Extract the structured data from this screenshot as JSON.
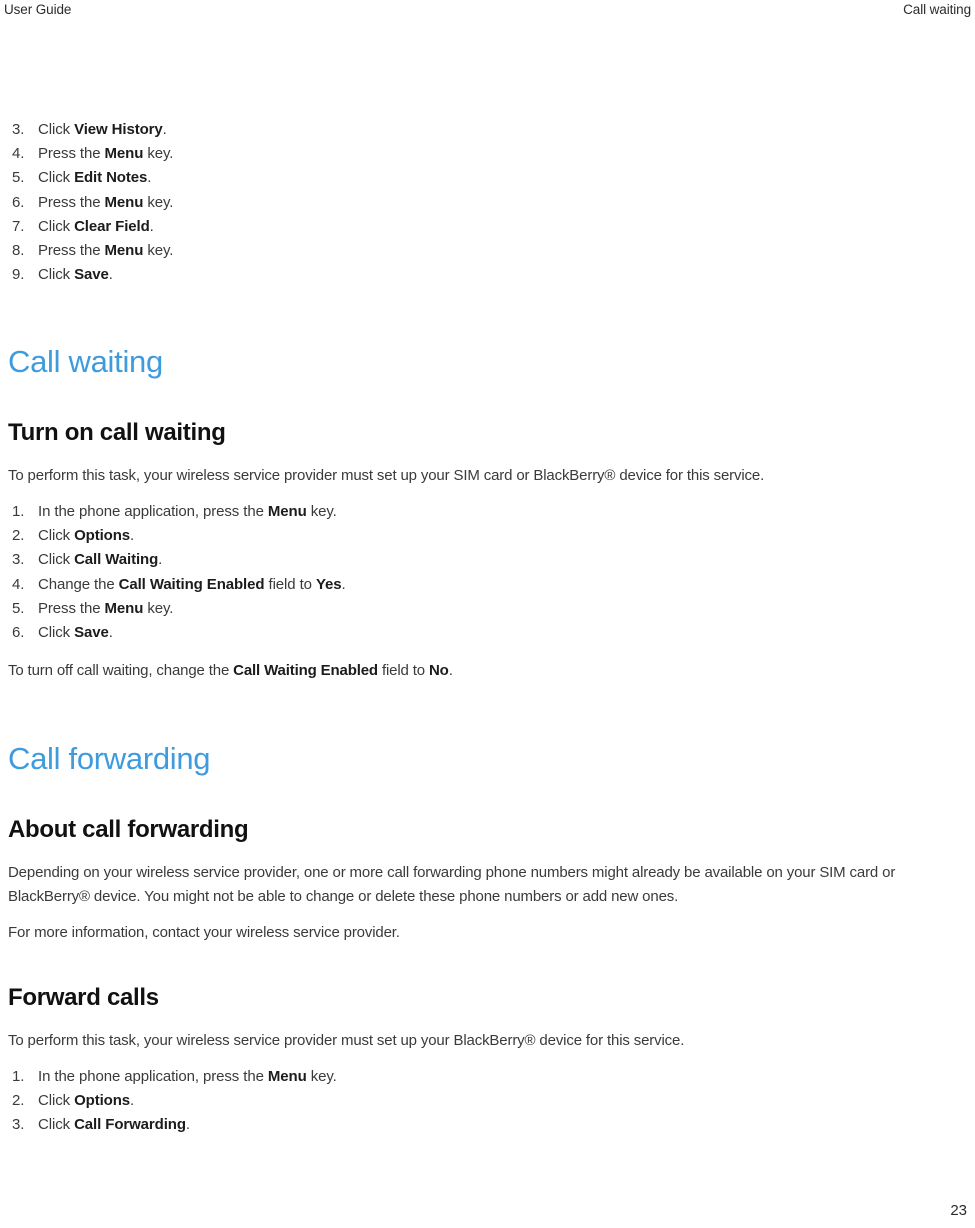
{
  "header": {
    "left": "User Guide",
    "right": "Call waiting"
  },
  "colors": {
    "chapter_heading": "#3e9bdd",
    "section_heading": "#111111",
    "body_text": "#3a3a3a",
    "page_background": "#ffffff"
  },
  "continued_list": {
    "items": [
      {
        "num": "3.",
        "html": "Click <b>View History</b>."
      },
      {
        "num": "4.",
        "html": "Press the <b>Menu</b> key."
      },
      {
        "num": "5.",
        "html": "Click <b>Edit Notes</b>."
      },
      {
        "num": "6.",
        "html": "Press the <b>Menu</b> key."
      },
      {
        "num": "7.",
        "html": "Click <b>Clear Field</b>."
      },
      {
        "num": "8.",
        "html": "Press the <b>Menu</b> key."
      },
      {
        "num": "9.",
        "html": "Click <b>Save</b>."
      }
    ]
  },
  "call_waiting": {
    "chapter_title": "Call waiting",
    "section_title": "Turn on call waiting",
    "intro": "To perform this task, your wireless service provider must set up your SIM card or BlackBerry® device for this service.",
    "steps": [
      {
        "num": "1.",
        "html": "In the phone application, press the <b>Menu</b> key."
      },
      {
        "num": "2.",
        "html": "Click <b>Options</b>."
      },
      {
        "num": "3.",
        "html": "Click <b>Call Waiting</b>."
      },
      {
        "num": "4.",
        "html": "Change the <b>Call Waiting Enabled</b> field to <b>Yes</b>."
      },
      {
        "num": "5.",
        "html": "Press the <b>Menu</b> key."
      },
      {
        "num": "6.",
        "html": "Click <b>Save</b>."
      }
    ],
    "outro_html": "To turn off call waiting, change the <b>Call Waiting Enabled</b> field to <b>No</b>."
  },
  "call_forwarding": {
    "chapter_title": "Call forwarding",
    "about_title": "About call forwarding",
    "about_paragraph": "Depending on your wireless service provider, one or more call forwarding phone numbers might already be available on your SIM card or BlackBerry® device. You might not be able to change or delete these phone numbers or add new ones.",
    "about_paragraph_2": "For more information, contact your wireless service provider.",
    "forward_title": "Forward calls",
    "forward_intro": "To perform this task, your wireless service provider must set up your BlackBerry® device for this service.",
    "forward_steps": [
      {
        "num": "1.",
        "html": "In the phone application, press the <b>Menu</b> key."
      },
      {
        "num": "2.",
        "html": "Click <b>Options</b>."
      },
      {
        "num": "3.",
        "html": "Click <b>Call Forwarding</b>."
      }
    ]
  },
  "footer": {
    "page_number": "23"
  }
}
